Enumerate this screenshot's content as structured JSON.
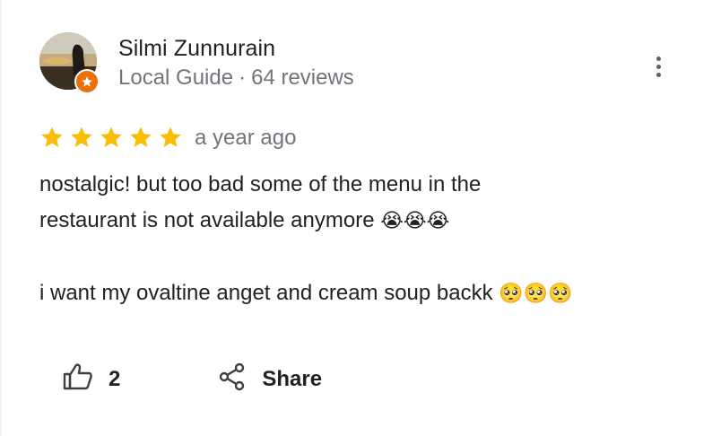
{
  "review": {
    "author_name": "Silmi Zunnurain",
    "author_level": "Local Guide",
    "separator": "·",
    "author_reviews": "64 reviews",
    "rating": 5,
    "rating_max": 5,
    "time_ago": "a year ago",
    "line1": "nostalgic! but too bad some of the menu in the",
    "line2_text": "restaurant is not available anymore",
    "line2_emoji": "😭😭😭",
    "line3_text": "i want my ovaltine anget and cream soup backk",
    "line3_emoji": "🥺🥺🥺"
  },
  "actions": {
    "like_count": "2",
    "share_label": "Share"
  },
  "colors": {
    "star": "#fbbc04",
    "badge": "#e8710a",
    "secondary_text": "#70757a",
    "primary_text": "#202124"
  }
}
